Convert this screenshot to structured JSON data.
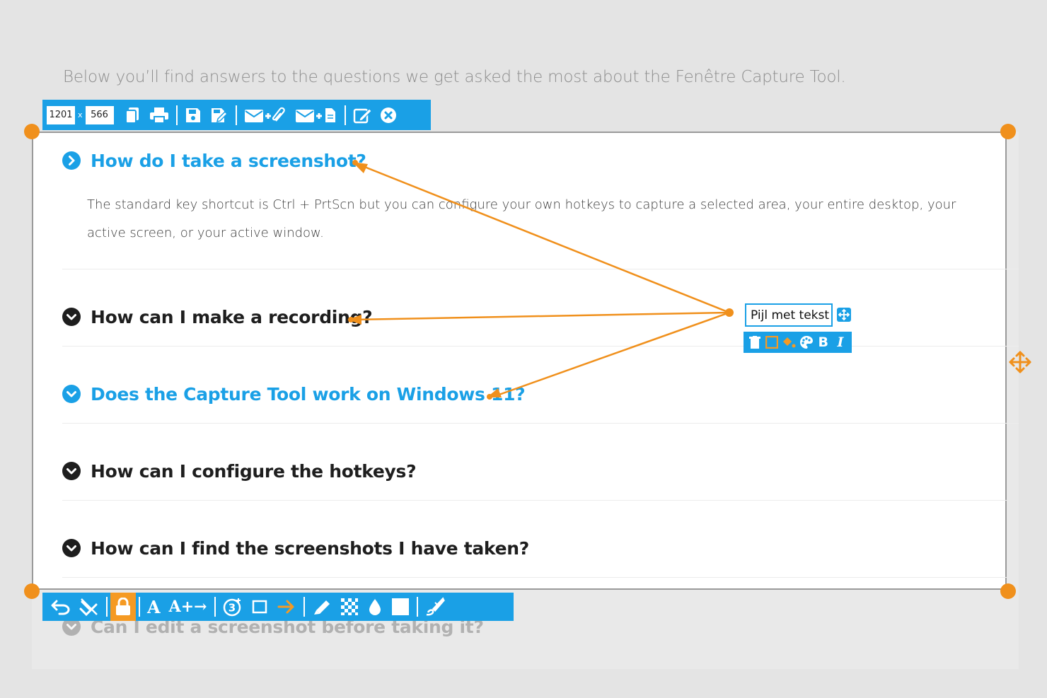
{
  "intro_text": "Below you’ll find answers to the questions we get asked the most about the Fenêtre Capture Tool.",
  "selection": {
    "width": "1201",
    "height": "566",
    "separator": "x"
  },
  "faq": [
    {
      "title": "How do I take a screenshot?",
      "state": "expanded",
      "color": "#1aa0e6"
    },
    {
      "title": "How can I make a recording?",
      "state": "collapsed",
      "color": "#1e1e1e"
    },
    {
      "title": "Does the Capture Tool work on Windows 11?",
      "state": "collapsed",
      "color": "#1aa0e6"
    },
    {
      "title": "How can I configure the hotkeys?",
      "state": "collapsed",
      "color": "#1e1e1e"
    },
    {
      "title": "How can I find the screenshots I have taken?",
      "state": "collapsed",
      "color": "#1e1e1e"
    },
    {
      "title": "Can I edit a screenshot before taking it?",
      "state": "collapsed",
      "color": "#8d8d8d"
    }
  ],
  "answer_text": "The standard key shortcut is Ctrl + PrtScn but you can configure your own hotkeys to capture a selected area, your entire desktop, your active screen, or your active window.",
  "annotation": {
    "text": "Pijl met tekst",
    "toolbar_bold": "B",
    "toolbar_italic": "I"
  },
  "top_toolbar_icons": [
    "copy-icon",
    "print-icon",
    "save-icon",
    "save-as-icon",
    "email-attach-icon",
    "email-document-icon",
    "edit-icon",
    "close-icon"
  ],
  "bottom_toolbar": {
    "icons": [
      "undo-icon",
      "clear-annotations-icon",
      "lock-icon",
      "text-icon",
      "arrow-text-icon",
      "step-counter-icon",
      "rectangle-icon",
      "arrow-icon",
      "highlighter-icon",
      "pixelate-icon",
      "blur-drop-icon",
      "fill-rectangle-icon",
      "brush-icon"
    ],
    "text_label": "A",
    "arrow_text_label": "A+→",
    "counter_label": "3"
  },
  "colors": {
    "accent": "#1aa0e6",
    "annotation": "#f0901c",
    "lock_active": "#f59a23"
  }
}
